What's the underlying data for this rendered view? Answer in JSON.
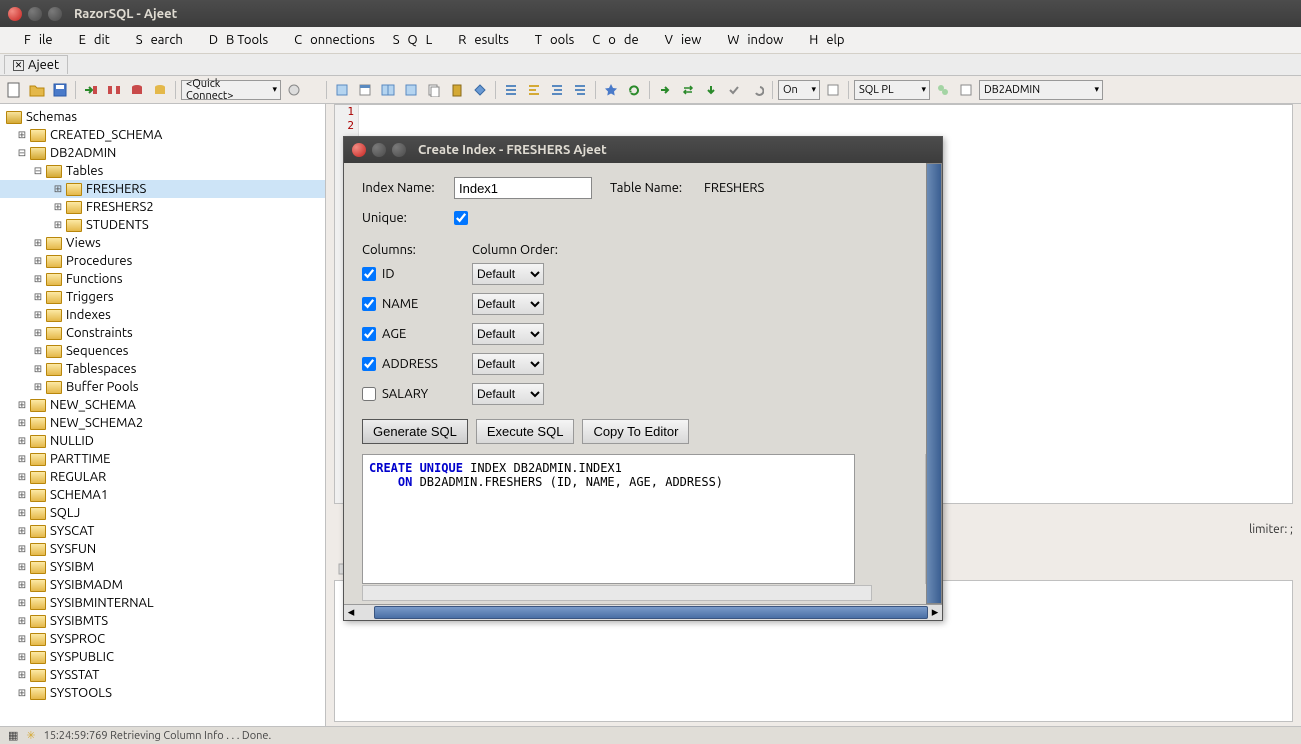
{
  "window": {
    "title": "RazorSQL - Ajeet"
  },
  "menu": {
    "file": "File",
    "edit": "Edit",
    "search": "Search",
    "dbtools": "DB Tools",
    "connections": "Connections",
    "sql": "SQL",
    "results": "Results",
    "tools": "Tools",
    "code": "Code",
    "view": "View",
    "window": "Window",
    "help": "Help"
  },
  "tab": {
    "close": "✕",
    "name": "Ajeet"
  },
  "toolbar": {
    "quick_connect": "<Quick Connect>",
    "on_label": "On",
    "lang": "SQL PL",
    "db": "DB2ADMIN"
  },
  "tree": {
    "root": "Schemas",
    "created_schema": "CREATED_SCHEMA",
    "db2admin": "DB2ADMIN",
    "tables": "Tables",
    "freshers": "FRESHERS",
    "freshers2": "FRESHERS2",
    "students": "STUDENTS",
    "views": "Views",
    "procedures": "Procedures",
    "functions": "Functions",
    "triggers": "Triggers",
    "indexes": "Indexes",
    "constraints": "Constraints",
    "sequences": "Sequences",
    "tablespaces": "Tablespaces",
    "bufferpools": "Buffer Pools",
    "new_schema": "NEW_SCHEMA",
    "new_schema2": "NEW_SCHEMA2",
    "nullid": "NULLID",
    "parttime": "PARTTIME",
    "regular": "REGULAR",
    "schema1": "SCHEMA1",
    "sqlj": "SQLJ",
    "syscat": "SYSCAT",
    "sysfun": "SYSFUN",
    "sysibm": "SYSIBM",
    "sysibmadm": "SYSIBMADM",
    "sysibminternal": "SYSIBMINTERNAL",
    "sysibmts": "SYSIBMTS",
    "sysproc": "SYSPROC",
    "syspublic": "SYSPUBLIC",
    "sysstat": "SYSSTAT",
    "systools": "SYSTOOLS"
  },
  "gutter": [
    "1",
    "2"
  ],
  "mid": {
    "limiter": "limiter: ;"
  },
  "dialog": {
    "title": "Create Index - FRESHERS Ajeet",
    "index_name_label": "Index Name:",
    "index_name_value": "Index1",
    "table_name_label": "Table Name:",
    "table_name_value": "FRESHERS",
    "unique_label": "Unique:",
    "columns_label": "Columns:",
    "column_order_label": "Column Order:",
    "cols": {
      "id": "ID",
      "name": "NAME",
      "age": "AGE",
      "address": "ADDRESS",
      "salary": "SALARY"
    },
    "order_default": "Default",
    "btn_generate": "Generate SQL",
    "btn_execute": "Execute SQL",
    "btn_copy": "Copy To Editor",
    "sql_line1_kw1": "CREATE UNIQUE",
    "sql_line1_rest": " INDEX DB2ADMIN.INDEX1",
    "sql_line2_kw": "ON",
    "sql_line2_rest": " DB2ADMIN.FRESHERS (ID, NAME, AGE, ADDRESS)"
  },
  "status": {
    "text": "15:24:59:769 Retrieving Column Info . . . Done."
  }
}
